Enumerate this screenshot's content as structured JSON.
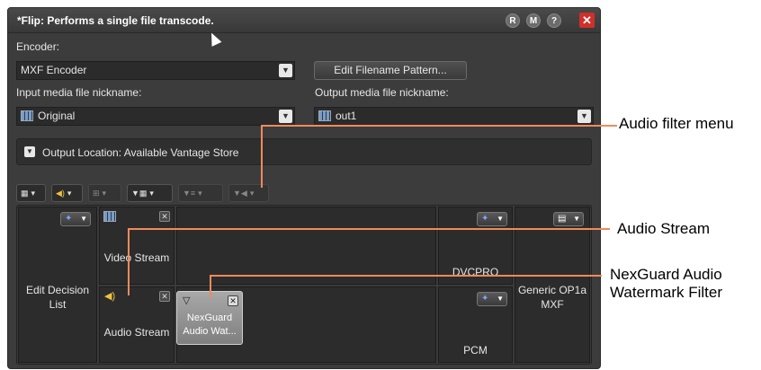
{
  "window": {
    "title": "*Flip: Performs a single file transcode.",
    "buttons": {
      "r": "R",
      "m": "M",
      "help": "?",
      "close": "✕"
    }
  },
  "encoder": {
    "label": "Encoder:",
    "value": "MXF Encoder"
  },
  "edit_pattern_button": "Edit Filename Pattern...",
  "input_media": {
    "label": "Input media file nickname:",
    "value": "Original"
  },
  "output_media": {
    "label": "Output media file nickname:",
    "value": "out1"
  },
  "output_location": "Output Location: Available Vantage Store",
  "grid": {
    "edl": "Edit Decision List",
    "video_stream": "Video Stream",
    "audio_stream": "Audio Stream",
    "video_codec": "DVCPRO",
    "audio_codec": "PCM",
    "container": "Generic OP1a MXF",
    "filter_card": "NexGuard Audio Wat..."
  },
  "callouts": {
    "audio_filter_menu": "Audio filter menu",
    "audio_stream": "Audio Stream",
    "nexguard": "NexGuard Audio Watermark Filter"
  },
  "colors": {
    "accent_line": "#f28a5a",
    "close_button": "#d0302a",
    "panel": "#3c3c3c"
  }
}
